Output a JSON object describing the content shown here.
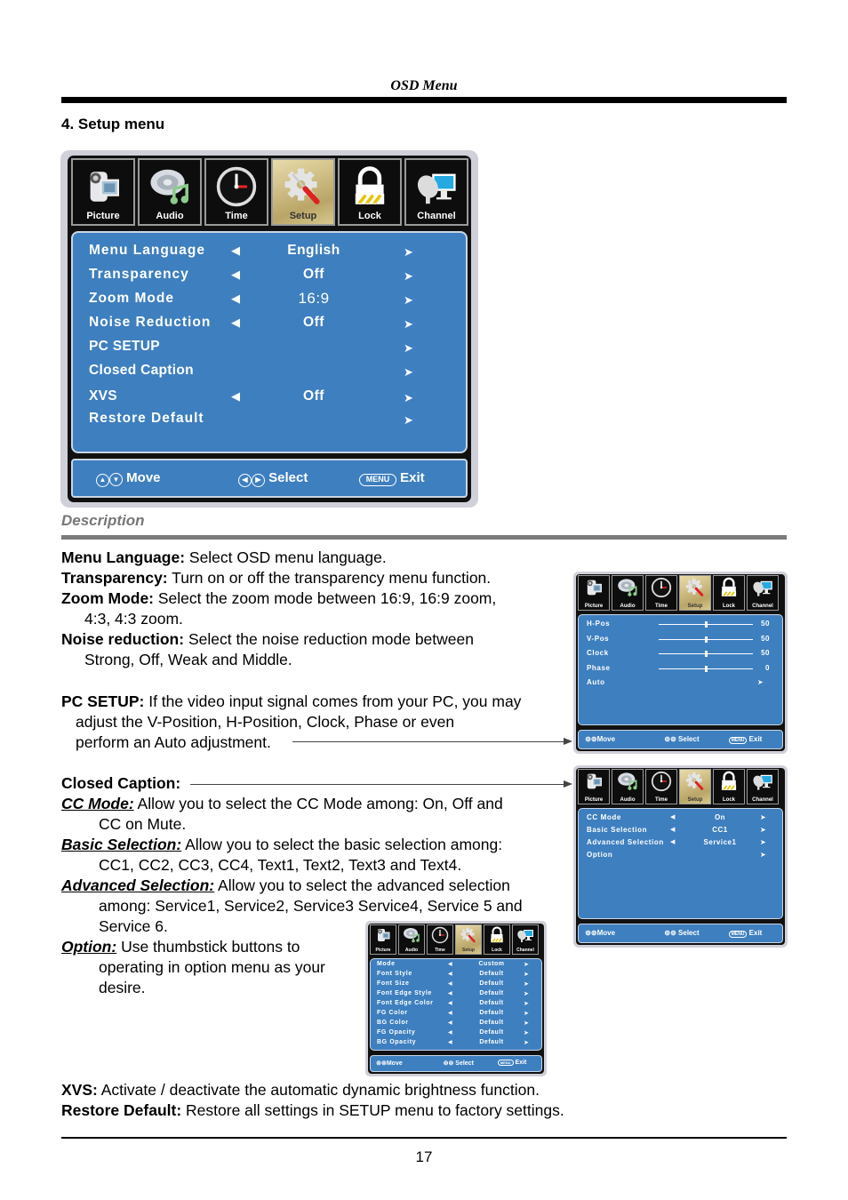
{
  "page": {
    "running_head": "OSD Menu",
    "section_title": "4. Setup menu",
    "page_number": "17"
  },
  "osd_main": {
    "tabs": [
      {
        "label": "Picture",
        "icon": "camcorder-icon"
      },
      {
        "label": "Audio",
        "icon": "music-disc-icon"
      },
      {
        "label": "Time",
        "icon": "clock-icon"
      },
      {
        "label": "Setup",
        "icon": "gear-screwdriver-icon",
        "active": true
      },
      {
        "label": "Lock",
        "icon": "padlock-icon"
      },
      {
        "label": "Channel",
        "icon": "satellite-monitor-icon"
      }
    ],
    "items": [
      {
        "label": "Menu Language",
        "value": "English",
        "left_arrow": true
      },
      {
        "label": "Transparency",
        "value": "Off",
        "left_arrow": true
      },
      {
        "label": "Zoom Mode",
        "value": "16:9",
        "left_arrow": true
      },
      {
        "label": "Noise Reduction",
        "value": "Off",
        "left_arrow": true
      },
      {
        "label": "PC SETUP",
        "value": "",
        "left_arrow": false
      },
      {
        "label": "Closed Caption",
        "value": "",
        "left_arrow": false
      },
      {
        "label": "XVS",
        "value": "Off",
        "left_arrow": true
      },
      {
        "label": "Restore Default",
        "value": "",
        "left_arrow": false
      }
    ],
    "footer": {
      "move": "Move",
      "select": "Select",
      "menu_key": "MENU",
      "exit": "Exit"
    }
  },
  "description": {
    "title": "Description",
    "menu_language": {
      "term": "Menu Language:",
      "text": " Select OSD menu language."
    },
    "transparency": {
      "term": "Transparency:",
      "text": " Turn on or off the transparency menu function."
    },
    "zoom_mode": {
      "term": "Zoom Mode:",
      "text": " Select the zoom mode between 16:9, 16:9 zoom,",
      "text2": "4:3, 4:3 zoom."
    },
    "noise_reduction": {
      "term": "Noise reduction:",
      "text": " Select the noise reduction mode between",
      "text2": "Strong, Off, Weak and Middle."
    },
    "pc_setup": {
      "term": "PC SETUP:",
      "text": " If the video input signal comes from your PC, you may",
      "text2": "adjust the V-Position, H-Position, Clock, Phase or even",
      "text3": "perform an Auto adjustment."
    },
    "closed_caption": {
      "term": "Closed Caption:"
    },
    "cc_mode": {
      "term": "CC Mode:",
      "text": " Allow you to select the CC Mode among: On, Off and",
      "text2": "CC on Mute."
    },
    "basic_selection": {
      "term": "Basic Selection:",
      "text": " Allow you to select the basic selection among:",
      "text2": "CC1, CC2, CC3, CC4, Text1, Text2, Text3 and Text4."
    },
    "advanced_selection": {
      "term": "Advanced Selection:",
      "text": " Allow you to select the advanced selection",
      "text2": "among: Service1, Service2, Service3 Service4, Service 5 and",
      "text3": "Service 6."
    },
    "option": {
      "term": "Option:",
      "text": " Use thumbstick buttons to",
      "text2": "operating in option menu as your",
      "text3": "desire."
    },
    "xvs": {
      "term": "XVS:",
      "text": " Activate / deactivate the automatic dynamic brightness function."
    },
    "restore_default": {
      "term": "Restore Default:",
      "text": " Restore all settings in SETUP menu to factory settings."
    }
  },
  "osd_pc": {
    "items": [
      {
        "label": "H-Pos",
        "value": "50",
        "level": 0.5
      },
      {
        "label": "V-Pos",
        "value": "50",
        "level": 0.5
      },
      {
        "label": "Clock",
        "value": "50",
        "level": 0.5
      },
      {
        "label": "Phase",
        "value": "0",
        "level": 0.5
      },
      {
        "label": "Auto",
        "value": ""
      }
    ],
    "footer": {
      "move": "Move",
      "select": "Select",
      "menu_key": "MENU",
      "exit": "Exit"
    }
  },
  "osd_cc": {
    "items": [
      {
        "label": "CC Mode",
        "value": "On"
      },
      {
        "label": "Basic Selection",
        "value": "CC1"
      },
      {
        "label": "Advanced Selection",
        "value": "Service1"
      },
      {
        "label": "Option",
        "value": ""
      }
    ],
    "footer": {
      "move": "Move",
      "select": "Select",
      "menu_key": "MENU",
      "exit": "Exit"
    }
  },
  "osd_option": {
    "items": [
      {
        "label": "Mode",
        "value": "Custom"
      },
      {
        "label": "Font Style",
        "value": "Default"
      },
      {
        "label": "Font Size",
        "value": "Default"
      },
      {
        "label": "Font Edge Style",
        "value": "Default"
      },
      {
        "label": "Font Edge Color",
        "value": "Default"
      },
      {
        "label": "FG Color",
        "value": "Default"
      },
      {
        "label": "BG Color",
        "value": "Default"
      },
      {
        "label": "FG Opacity",
        "value": "Default"
      },
      {
        "label": "BG Opacity",
        "value": "Default"
      }
    ],
    "footer": {
      "move": "Move",
      "select": "Select",
      "menu_key": "MENU",
      "exit": "Exit"
    }
  },
  "colors": {
    "osd_blue": "#3e7fbf",
    "osd_frame": "#cfd0d8",
    "tab_active": "#c9b77a",
    "description_gray": "#777777"
  }
}
